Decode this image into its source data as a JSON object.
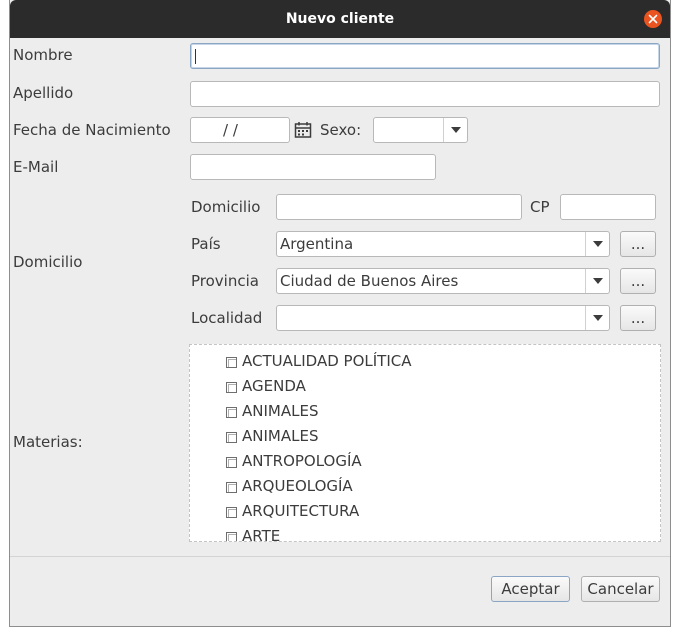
{
  "window": {
    "title": "Nuevo cliente"
  },
  "form": {
    "nombre": {
      "label": "Nombre",
      "value": ""
    },
    "apellido": {
      "label": "Apellido",
      "value": ""
    },
    "fecha": {
      "label": "Fecha de Nacimiento",
      "value": "/ /"
    },
    "sexo": {
      "label": "Sexo:",
      "value": ""
    },
    "email": {
      "label": "E-Mail",
      "value": ""
    },
    "domicilio_group_label": "Domicilio",
    "domicilio": {
      "label": "Domicilio",
      "value": ""
    },
    "cp": {
      "label": "CP",
      "value": ""
    },
    "pais": {
      "label": "País",
      "value": "Argentina"
    },
    "provincia": {
      "label": "Provincia",
      "value": "Ciudad de Buenos Aires"
    },
    "localidad": {
      "label": "Localidad",
      "value": ""
    },
    "browse_label": "...",
    "materias": {
      "label": "Materias:",
      "items": [
        {
          "label": "ACTUALIDAD POLÍTICA",
          "checked": false
        },
        {
          "label": "AGENDA",
          "checked": false
        },
        {
          "label": "ANIMALES",
          "checked": false
        },
        {
          "label": "ANIMALES",
          "checked": false
        },
        {
          "label": "ANTROPOLOGÍA",
          "checked": false
        },
        {
          "label": "ARQUEOLOGÍA",
          "checked": false
        },
        {
          "label": "ARQUITECTURA",
          "checked": false
        },
        {
          "label": "ARTE",
          "checked": false
        }
      ]
    }
  },
  "buttons": {
    "accept": "Aceptar",
    "cancel": "Cancelar"
  },
  "colors": {
    "titlebar": "#2b2b2b",
    "close": "#e95420",
    "dialog_bg": "#ededed",
    "focus_border": "#8aa6c4"
  },
  "icons": {
    "close": "close-icon",
    "calendar": "calendar-icon",
    "dropdown": "chevron-down-icon"
  }
}
